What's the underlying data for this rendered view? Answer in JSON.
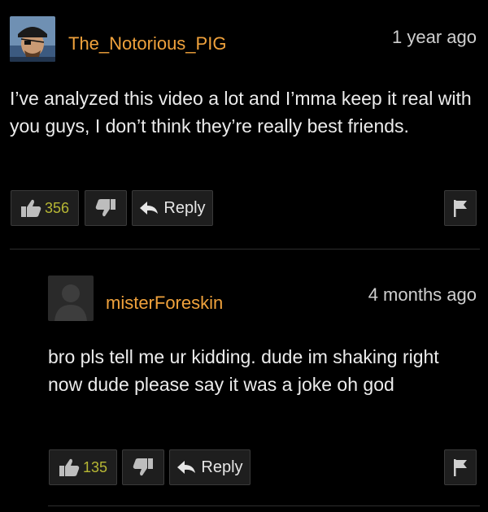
{
  "comments": [
    {
      "username": "The_Notorious_PIG",
      "timestamp": "1 year ago",
      "body": "I’ve analyzed this video a lot and I’mma keep it real with you guys, I don’t think they’re really best friends.",
      "likes": "356",
      "reply_label": "Reply"
    },
    {
      "username": "misterForeskin",
      "timestamp": "4 months ago",
      "body": "bro pls tell me ur kidding. dude im shaking right now dude please say it was a joke oh god",
      "likes": "135",
      "reply_label": "Reply"
    }
  ],
  "colors": {
    "username": "#f0a23c",
    "like_count": "#b7b734",
    "button_bg": "#1e1e1e",
    "background": "#000000"
  },
  "icons": {
    "like": "thumbs-up-icon",
    "dislike": "thumbs-down-icon",
    "reply": "reply-arrow-icon",
    "flag": "flag-icon"
  }
}
